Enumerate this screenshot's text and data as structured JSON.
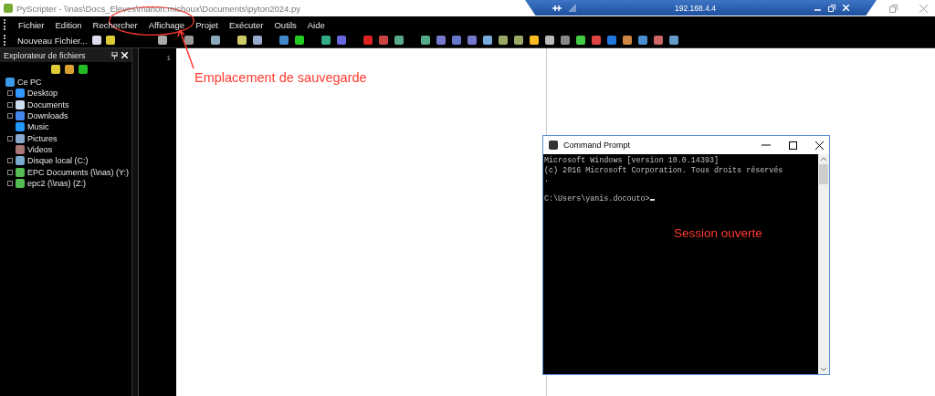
{
  "window": {
    "title": "PyScripter - \\\\nas\\Docs_Eleves\\manon.michoux\\Documents\\pyton2024.py"
  },
  "remote_bar": {
    "title": "192.168.4.4"
  },
  "menu": [
    "Fichier",
    "Edition",
    "Rechercher",
    "Affichage",
    "Projet",
    "Exécuter",
    "Outils",
    "Aide"
  ],
  "toolbar": {
    "new_file": "Nouveau Fichier..."
  },
  "explorer": {
    "title": "Explorateur de fichiers",
    "tree": {
      "label": "Ce PC",
      "children": [
        {
          "label": "Desktop",
          "expandable": true
        },
        {
          "label": "Documents",
          "expandable": true
        },
        {
          "label": "Downloads",
          "expandable": true
        },
        {
          "label": "Music",
          "expandable": false
        },
        {
          "label": "Pictures",
          "expandable": true
        },
        {
          "label": "Videos",
          "expandable": false
        },
        {
          "label": "Disque local (C:)",
          "expandable": true
        },
        {
          "label": "EPC Documents (\\\\nas) (Y:)",
          "expandable": true
        },
        {
          "label": "epc2 (\\\\nas) (Z:)",
          "expandable": true
        }
      ]
    }
  },
  "editor": {
    "line_numbers": [
      "1"
    ]
  },
  "command_prompt": {
    "title": "Command Prompt",
    "lines": [
      "Microsoft Windows [version 10.0.14393]",
      "(c) 2016 Microsoft Corporation. Tous droits réservés",
      "."
    ],
    "prompt": "C:\\Users\\yanis.docouto>"
  },
  "annotations": [
    {
      "text": "Emplacement de sauvegarde"
    },
    {
      "text": "Session ouverte"
    }
  ]
}
